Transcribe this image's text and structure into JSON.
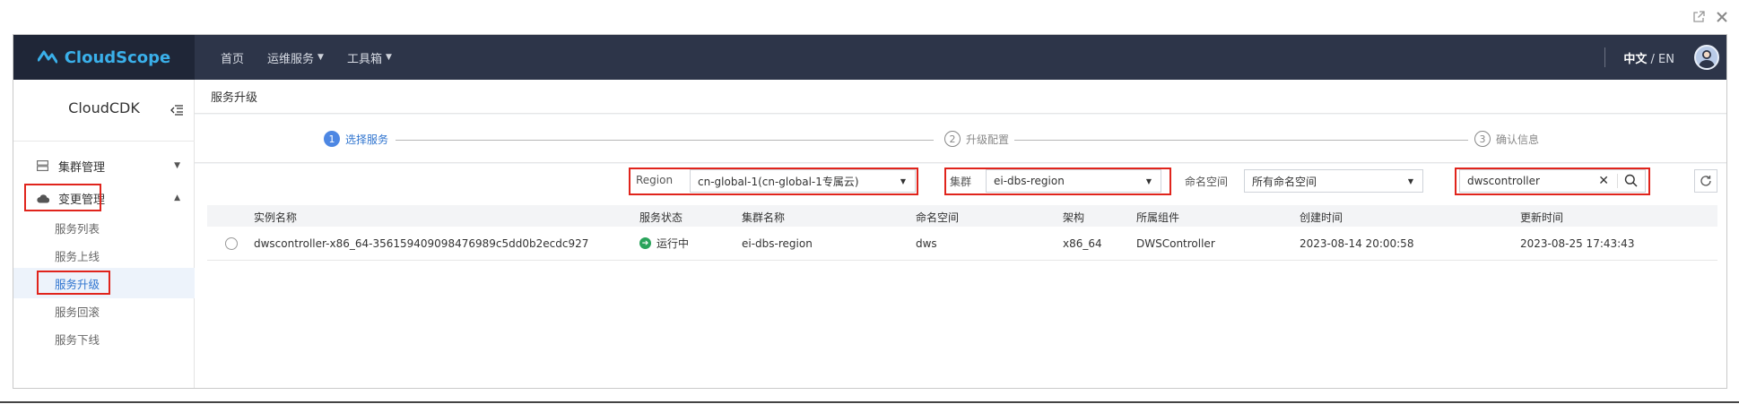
{
  "app": {
    "brand": "CloudScope",
    "nav": [
      {
        "label": "首页"
      },
      {
        "label": "运维服务"
      },
      {
        "label": "工具箱"
      }
    ],
    "lang_zh": "中文",
    "lang_sep": " / ",
    "lang_en": "EN"
  },
  "sidebar": {
    "title": "CloudCDK",
    "groups": [
      {
        "label": "集群管理"
      },
      {
        "label": "变更管理"
      }
    ],
    "items": [
      {
        "label": "服务列表"
      },
      {
        "label": "服务上线"
      },
      {
        "label": "服务升级"
      },
      {
        "label": "服务回滚"
      },
      {
        "label": "服务下线"
      }
    ]
  },
  "page": {
    "title": "服务升级",
    "steps": [
      {
        "num": "1",
        "label": "选择服务"
      },
      {
        "num": "2",
        "label": "升级配置"
      },
      {
        "num": "3",
        "label": "确认信息"
      }
    ]
  },
  "filters": {
    "region_label": "Region",
    "region_value": "cn-global-1(cn-global-1专属云)",
    "cluster_label": "集群",
    "cluster_value": "ei-dbs-region",
    "namespace_label": "命名空间",
    "namespace_value": "所有命名空间",
    "search_value": "dwscontroller"
  },
  "table": {
    "columns": [
      "实例名称",
      "服务状态",
      "集群名称",
      "命名空间",
      "架构",
      "所属组件",
      "创建时间",
      "更新时间"
    ],
    "rows": [
      {
        "name": "dwscontroller-x86_64-356159409098476989c5dd0b2ecdc927",
        "status": "运行中",
        "cluster": "ei-dbs-region",
        "namespace": "dws",
        "arch": "x86_64",
        "component": "DWSController",
        "created": "2023-08-14 20:00:58",
        "updated": "2023-08-25 17:43:43"
      }
    ]
  },
  "colors": {
    "accent": "#2f74cf",
    "navbar": "#2d3549",
    "highlight": "#e0241c",
    "status_ok": "#2aa35b"
  }
}
